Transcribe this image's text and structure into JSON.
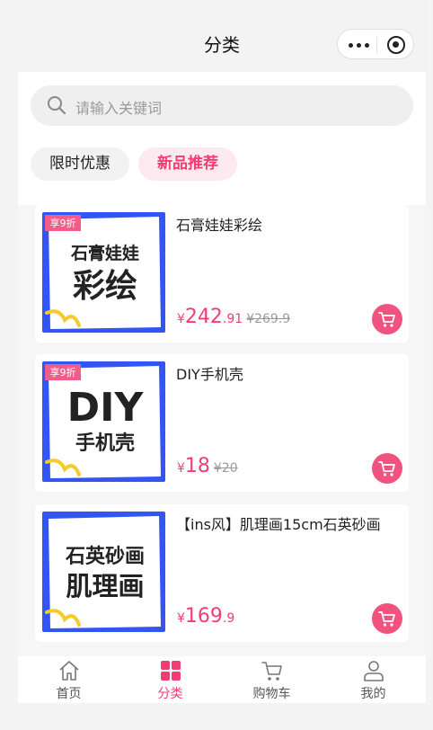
{
  "header": {
    "title": "分类"
  },
  "search": {
    "placeholder": "请输入关键词"
  },
  "tabs": [
    {
      "label": "限时优惠",
      "active": false
    },
    {
      "label": "新品推荐",
      "active": true
    }
  ],
  "products": [
    {
      "name": "石膏娃娃彩绘",
      "badge": "享9折",
      "thumb_line1": "石膏娃娃",
      "thumb_line2": "彩绘",
      "price_symbol": "¥",
      "price_int": "242",
      "price_dec": ".91",
      "old_price": "¥269.9"
    },
    {
      "name": "DIY手机壳",
      "badge": "享9折",
      "thumb_line1": "DIY",
      "thumb_line2": "手机壳",
      "price_symbol": "¥",
      "price_int": "18",
      "price_dec": "",
      "old_price": "¥20"
    },
    {
      "name": "【ins风】肌理画15cm石英砂画",
      "badge": "",
      "thumb_line1": "石英砂画",
      "thumb_line2": "肌理画",
      "price_symbol": "¥",
      "price_int": "169",
      "price_dec": ".9",
      "old_price": ""
    }
  ],
  "nav": [
    {
      "label": "首页",
      "icon": "home-icon",
      "active": false
    },
    {
      "label": "分类",
      "icon": "category-grid-icon",
      "active": true
    },
    {
      "label": "购物车",
      "icon": "cart-icon",
      "active": false
    },
    {
      "label": "我的",
      "icon": "user-icon",
      "active": false
    }
  ],
  "colors": {
    "accent": "#f23d72",
    "thumb_blue": "#3355f5",
    "badge": "#f25c8a"
  }
}
